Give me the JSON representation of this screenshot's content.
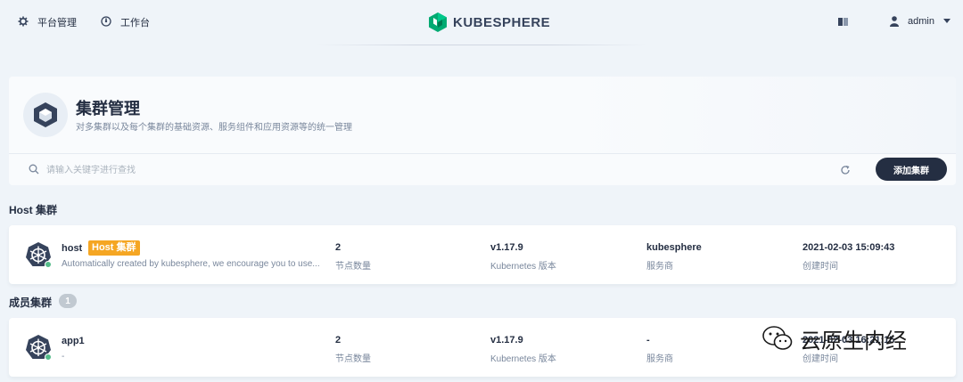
{
  "header": {
    "nav": [
      {
        "label": "平台管理",
        "icon": "gear-icon"
      },
      {
        "label": "工作台",
        "icon": "dashboard-icon"
      }
    ],
    "logo_text": "KUBESPHERE",
    "user": {
      "name": "admin"
    }
  },
  "banner": {
    "title": "集群管理",
    "description": "对多集群以及每个集群的基础资源、服务组件和应用资源等的统一管理"
  },
  "toolbar": {
    "search_placeholder": "请输入关键字进行查找",
    "add_label": "添加集群"
  },
  "host_section": {
    "title": "Host 集群"
  },
  "member_section": {
    "title": "成员集群",
    "count": "1"
  },
  "clusters": [
    {
      "name": "host",
      "tag": "Host 集群",
      "description": "Automatically created by kubesphere, we encourage you to use...",
      "nodes": "2",
      "nodes_label": "节点数量",
      "version": "v1.17.9",
      "version_label": "Kubernetes 版本",
      "provider": "kubesphere",
      "provider_label": "服务商",
      "created": "2021-02-03 15:09:43",
      "created_label": "创建时间"
    },
    {
      "name": "app1",
      "description": "-",
      "nodes": "2",
      "nodes_label": "节点数量",
      "version": "v1.17.9",
      "version_label": "Kubernetes 版本",
      "provider": "-",
      "provider_label": "服务商",
      "created": "2021-02-03 16:21:15",
      "created_label": "创建时间"
    }
  ],
  "watermark": {
    "text": "云原生内经"
  },
  "colors": {
    "background": "#eff4f9",
    "dark": "#242e42",
    "brand_green": "#00aa72",
    "host_tag": "#f5a623",
    "status_ok": "#55bc8a"
  }
}
